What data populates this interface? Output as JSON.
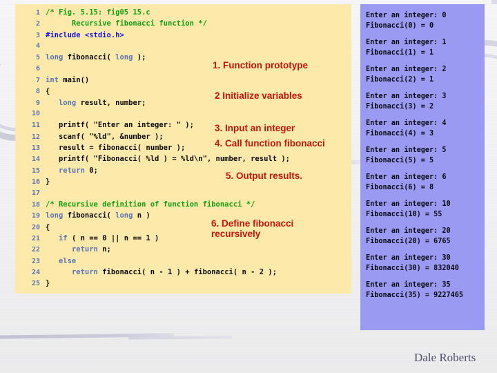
{
  "slide": {
    "footer_author": "Dale Roberts",
    "accent_red": "#c8150c",
    "code_bg": "#fde9a9",
    "output_bg": "#9a9af2",
    "linenum_color": "#5b76b3",
    "comment_color": "#12a012",
    "preproc_color": "#1717e0"
  },
  "code": {
    "lines": [
      {
        "n": "1",
        "segments": [
          {
            "t": "/* Fig. 5.15: fig05 15.c",
            "cls": "c-comment"
          }
        ]
      },
      {
        "n": "2",
        "segments": [
          {
            "t": "      Recursive fibonacci function */",
            "cls": "c-comment"
          }
        ]
      },
      {
        "n": "3",
        "segments": [
          {
            "t": "#include <stdio.h>",
            "cls": "c-pre"
          }
        ]
      },
      {
        "n": "4",
        "segments": [
          {
            "t": "",
            "cls": "c-plain"
          }
        ]
      },
      {
        "n": "5",
        "segments": [
          {
            "t": "long",
            "cls": "c-kw"
          },
          {
            "t": " fibonacci( ",
            "cls": "c-plain"
          },
          {
            "t": "long",
            "cls": "c-kw"
          },
          {
            "t": " );",
            "cls": "c-plain"
          }
        ]
      },
      {
        "n": "6",
        "segments": [
          {
            "t": "",
            "cls": "c-plain"
          }
        ]
      },
      {
        "n": "7",
        "segments": [
          {
            "t": "int",
            "cls": "c-kw"
          },
          {
            "t": " main()",
            "cls": "c-plain"
          }
        ]
      },
      {
        "n": "8",
        "segments": [
          {
            "t": "{",
            "cls": "c-plain"
          }
        ]
      },
      {
        "n": "9",
        "segments": [
          {
            "t": "   ",
            "cls": "c-plain"
          },
          {
            "t": "long",
            "cls": "c-kw"
          },
          {
            "t": " result, number;",
            "cls": "c-plain"
          }
        ]
      },
      {
        "n": "10",
        "segments": [
          {
            "t": "",
            "cls": "c-plain"
          }
        ]
      },
      {
        "n": "11",
        "segments": [
          {
            "t": "   printf( \"Enter an integer: \" );",
            "cls": "c-plain"
          }
        ]
      },
      {
        "n": "12",
        "segments": [
          {
            "t": "   scanf( \"%ld\", &number );",
            "cls": "c-plain"
          }
        ]
      },
      {
        "n": "13",
        "segments": [
          {
            "t": "   result = fibonacci( number );",
            "cls": "c-plain"
          }
        ]
      },
      {
        "n": "14",
        "segments": [
          {
            "t": "   printf( \"Fibonacci( %ld ) = %ld\\n\", number, result );",
            "cls": "c-plain"
          }
        ]
      },
      {
        "n": "15",
        "segments": [
          {
            "t": "   ",
            "cls": "c-plain"
          },
          {
            "t": "return",
            "cls": "c-kw"
          },
          {
            "t": " 0;",
            "cls": "c-plain"
          }
        ]
      },
      {
        "n": "16",
        "segments": [
          {
            "t": "}",
            "cls": "c-plain"
          }
        ]
      },
      {
        "n": "17",
        "segments": [
          {
            "t": "",
            "cls": "c-plain"
          }
        ]
      },
      {
        "n": "18",
        "segments": [
          {
            "t": "/* Recursive definition of function fibonacci */",
            "cls": "c-comment"
          }
        ]
      },
      {
        "n": "19",
        "segments": [
          {
            "t": "long",
            "cls": "c-kw"
          },
          {
            "t": " fibonacci( ",
            "cls": "c-plain"
          },
          {
            "t": "long",
            "cls": "c-kw"
          },
          {
            "t": " n )",
            "cls": "c-plain"
          }
        ]
      },
      {
        "n": "20",
        "segments": [
          {
            "t": "{",
            "cls": "c-plain"
          }
        ]
      },
      {
        "n": "21",
        "segments": [
          {
            "t": "   ",
            "cls": "c-plain"
          },
          {
            "t": "if",
            "cls": "c-kw"
          },
          {
            "t": " ( n == 0 || n == 1 )",
            "cls": "c-plain"
          }
        ]
      },
      {
        "n": "22",
        "segments": [
          {
            "t": "      ",
            "cls": "c-plain"
          },
          {
            "t": "return",
            "cls": "c-kw"
          },
          {
            "t": " n;",
            "cls": "c-plain"
          }
        ]
      },
      {
        "n": "23",
        "segments": [
          {
            "t": "   ",
            "cls": "c-plain"
          },
          {
            "t": "else",
            "cls": "c-kw"
          }
        ]
      },
      {
        "n": "24",
        "segments": [
          {
            "t": "      ",
            "cls": "c-plain"
          },
          {
            "t": "return",
            "cls": "c-kw"
          },
          {
            "t": " fibonacci( n - 1 ) + fibonacci( n - 2 );",
            "cls": "c-plain"
          }
        ]
      },
      {
        "n": "25",
        "segments": [
          {
            "t": "}",
            "cls": "c-plain"
          }
        ]
      }
    ]
  },
  "annotations": [
    {
      "id": "anno-1",
      "text": "1.  Function prototype"
    },
    {
      "id": "anno-2",
      "text": "2  Initialize variables"
    },
    {
      "id": "anno-3",
      "text": "3.  Input an integer"
    },
    {
      "id": "anno-4",
      "text": "4.  Call function  fibonacci"
    },
    {
      "id": "anno-5",
      "text": "5.  Output results."
    },
    {
      "id": "anno-6",
      "text": "6.  Define fibonacci recursively"
    }
  ],
  "output": {
    "groups": [
      {
        "prompt": "Enter an integer: 0",
        "result": "Fibonacci(0) = 0"
      },
      {
        "prompt": "Enter an integer: 1",
        "result": "Fibonacci(1) = 1"
      },
      {
        "prompt": "Enter an integer: 2",
        "result": "Fibonacci(2) = 1"
      },
      {
        "prompt": "Enter an integer: 3",
        "result": "Fibonacci(3) = 2"
      },
      {
        "prompt": "Enter an integer: 4",
        "result": "Fibonacci(4) = 3"
      },
      {
        "prompt": "Enter an integer: 5",
        "result": "Fibonacci(5) = 5"
      },
      {
        "prompt": "Enter an integer: 6",
        "result": "Fibonacci(6) = 8"
      },
      {
        "prompt": "Enter an integer: 10",
        "result": "Fibonacci(10) = 55"
      },
      {
        "prompt": "Enter an integer: 20",
        "result": "Fibonacci(20) = 6765"
      },
      {
        "prompt": "Enter an integer: 30",
        "result": "Fibonacci(30) = 832040"
      },
      {
        "prompt": "Enter an integer: 35",
        "result": "Fibonacci(35) = 9227465"
      }
    ]
  }
}
